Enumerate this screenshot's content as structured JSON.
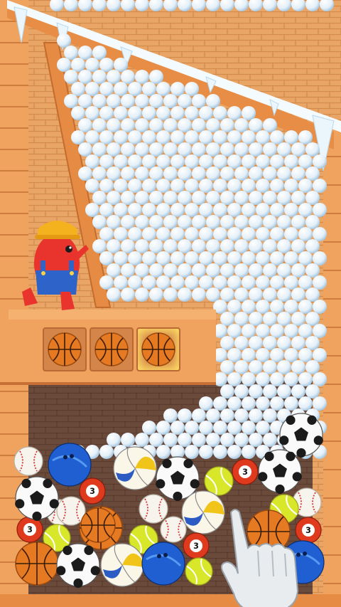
{
  "game": {
    "title": "",
    "colors": {
      "wall": "#ee9b55",
      "wall_dark": "#c86f35",
      "snow": "#e6f2fb",
      "ball_shadow": "#9fc2dd",
      "shelf": "#f0a560"
    },
    "tray": {
      "slots": [
        {
          "item": "basketball",
          "icon": "basketball-icon",
          "highlighted": false
        },
        {
          "item": "basketball",
          "icon": "basketball-icon",
          "highlighted": false
        },
        {
          "item": "basketball",
          "icon": "basketball-icon",
          "highlighted": true
        }
      ]
    },
    "bin_balls": [
      {
        "type": "baseball"
      },
      {
        "type": "bowling"
      },
      {
        "type": "volleyball"
      },
      {
        "type": "soccer"
      },
      {
        "type": "tennis"
      },
      {
        "type": "pool3"
      },
      {
        "type": "soccer"
      },
      {
        "type": "soccer"
      },
      {
        "type": "pool3"
      },
      {
        "type": "baseball"
      },
      {
        "type": "basketball"
      },
      {
        "type": "baseball"
      },
      {
        "type": "baseball"
      },
      {
        "type": "volleyball"
      },
      {
        "type": "tennis"
      },
      {
        "type": "baseball"
      },
      {
        "type": "pool3"
      },
      {
        "type": "tennis"
      },
      {
        "type": "basketball"
      },
      {
        "type": "tennis"
      },
      {
        "type": "baseball"
      },
      {
        "type": "pool3"
      },
      {
        "type": "basketball"
      },
      {
        "type": "soccer"
      },
      {
        "type": "volleyball"
      },
      {
        "type": "bowling"
      },
      {
        "type": "pool3"
      },
      {
        "type": "tennis"
      },
      {
        "type": "soccer"
      },
      {
        "type": "bowling"
      },
      {
        "type": "basketball"
      }
    ],
    "pool_ball_number": "3",
    "character": {
      "name": "worker-character",
      "hat_color": "#f5b21f",
      "body_color": "#e8342d",
      "overalls_color": "#2e64c9"
    },
    "tutorial": {
      "icon": "pointing-hand-icon"
    }
  }
}
